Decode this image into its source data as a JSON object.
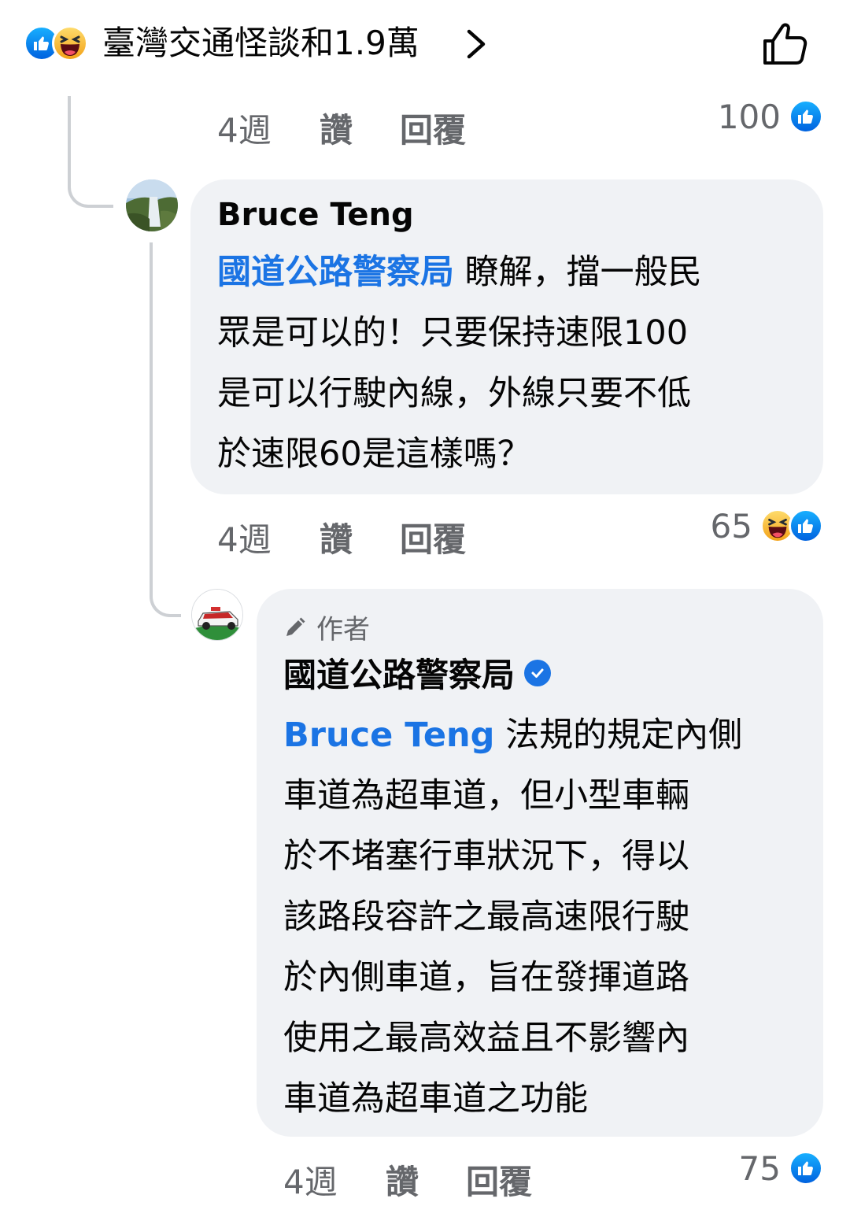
{
  "reaction_summary": {
    "text": "臺灣交通怪談和1.9萬"
  },
  "comment_parent_actions": {
    "time": "4週",
    "like": "讚",
    "reply": "回覆",
    "reaction_count": "100"
  },
  "comment_1": {
    "author": "Bruce Teng",
    "mention": "國道公路警察局",
    "line1_rest": " 瞭解，擋一般民",
    "line2": "眾是可以的！只要保持速限100",
    "line3": "是可以行駛內線，外線只要不低",
    "line4": "於速限60是這樣嗎？",
    "time": "4週",
    "like": "讚",
    "reply": "回覆",
    "reaction_count": "65"
  },
  "comment_2": {
    "author_tag": "作者",
    "author": "國道公路警察局",
    "mention": "Bruce Teng",
    "line1_rest": " 法規的規定內側",
    "line2": "車道為超車道，但小型車輛",
    "line3": "於不堵塞行車狀況下，得以",
    "line4": "該路段容許之最高速限行駛",
    "line5": "於內側車道，旨在發揮道路",
    "line6": "使用之最高效益且不影響內",
    "line7": "車道為超車道之功能",
    "time": "4週",
    "like": "讚",
    "reply": "回覆",
    "reaction_count": "75"
  },
  "colors": {
    "link_blue": "#1b74e4",
    "bubble_bg": "#f0f2f5",
    "meta_gray": "#65676b",
    "thread_line": "#cdd0d4"
  },
  "icons": [
    "like-reaction-icon",
    "haha-reaction-icon",
    "chevron-right-icon",
    "thumbs-up-outline-icon",
    "verified-badge-icon",
    "pencil-icon"
  ]
}
